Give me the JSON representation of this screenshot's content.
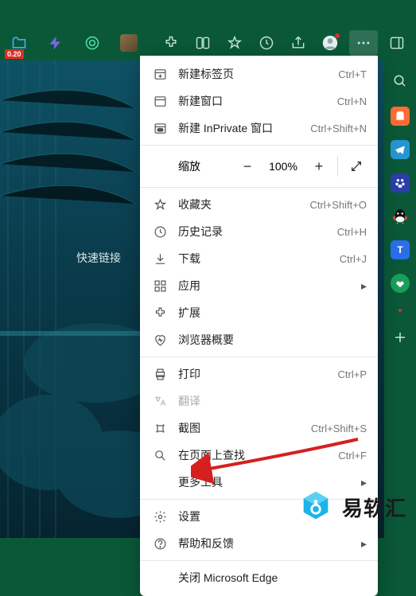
{
  "toolbar": {
    "folder_badge": "0.20"
  },
  "quick_links_label": "快速链接",
  "menu": {
    "new_tab": {
      "label": "新建标签页",
      "shortcut": "Ctrl+T"
    },
    "new_window": {
      "label": "新建窗口",
      "shortcut": "Ctrl+N"
    },
    "new_inprivate": {
      "label": "新建 InPrivate 窗口",
      "shortcut": "Ctrl+Shift+N"
    },
    "zoom": {
      "label": "缩放",
      "value": "100%"
    },
    "favorites": {
      "label": "收藏夹",
      "shortcut": "Ctrl+Shift+O"
    },
    "history": {
      "label": "历史记录",
      "shortcut": "Ctrl+H"
    },
    "downloads": {
      "label": "下载",
      "shortcut": "Ctrl+J"
    },
    "apps": {
      "label": "应用"
    },
    "extensions": {
      "label": "扩展"
    },
    "browser_essentials": {
      "label": "浏览器概要"
    },
    "print": {
      "label": "打印",
      "shortcut": "Ctrl+P"
    },
    "translate": {
      "label": "翻译"
    },
    "screenshot": {
      "label": "截图",
      "shortcut": "Ctrl+Shift+S"
    },
    "find": {
      "label": "在页面上查找",
      "shortcut": "Ctrl+F"
    },
    "more_tools": {
      "label": "更多工具"
    },
    "settings": {
      "label": "设置"
    },
    "help": {
      "label": "帮助和反馈"
    },
    "close": {
      "label": "关闭 Microsoft Edge"
    }
  },
  "watermark": "易软汇"
}
